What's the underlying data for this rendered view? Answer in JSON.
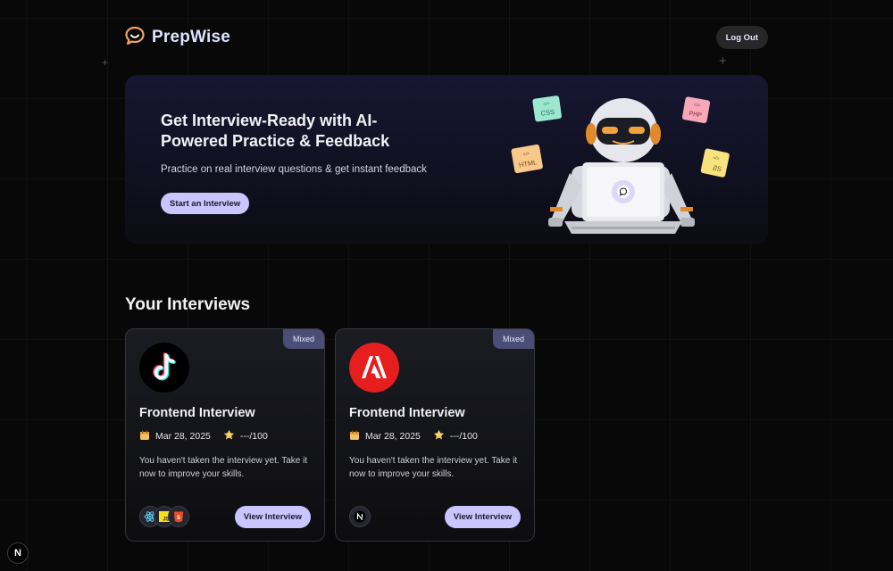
{
  "nav": {
    "brand": "PrepWise",
    "logout_label": "Log Out"
  },
  "hero": {
    "title": "Get Interview-Ready with AI-Powered Practice & Feedback",
    "subtitle": "Practice on real interview questions & get instant feedback",
    "cta_label": "Start an Interview",
    "stickers": [
      "CSS",
      "PHP",
      "HTML",
      "JS"
    ]
  },
  "section": {
    "title": "Your Interviews"
  },
  "interviews": [
    {
      "badge": "Mixed",
      "logo": "tiktok-logo",
      "title": "Frontend Interview",
      "date": "Mar 28, 2025",
      "score": "---/100",
      "description": "You haven't taken the interview yet. Take it now to improve your skills.",
      "tech": [
        "react-icon",
        "javascript-icon",
        "html5-icon"
      ],
      "button_label": "View Interview"
    },
    {
      "badge": "Mixed",
      "logo": "adobe-logo",
      "title": "Frontend Interview",
      "date": "Mar 28, 2025",
      "score": "---/100",
      "description": "You haven't taken the interview yet. Take it now to improve your skills.",
      "tech": [
        "nextjs-icon"
      ],
      "button_label": "View Interview"
    }
  ],
  "dev_badge": {
    "label": "N"
  },
  "colors": {
    "accent": "#cac5fe",
    "badge": "#4a4d75",
    "background": "#080808",
    "brand_text": "#dde3ff"
  }
}
